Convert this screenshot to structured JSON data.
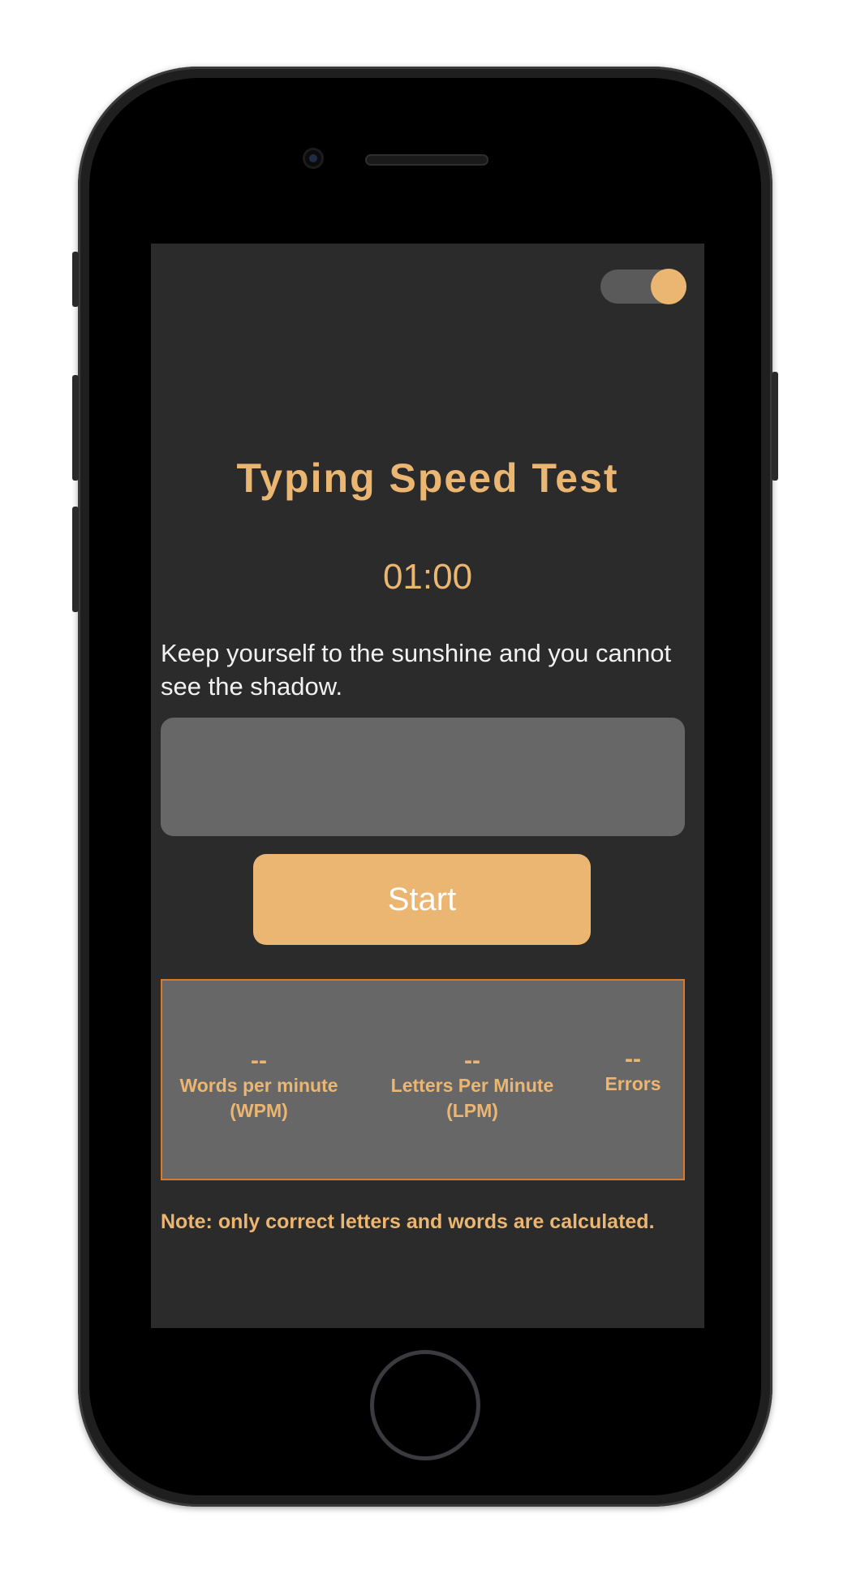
{
  "theme_toggle": {
    "state": "on",
    "accent_color": "#ebb672",
    "track_color": "#5a5a5a"
  },
  "app": {
    "title": "Typing Speed Test",
    "timer": "01:00",
    "prompt_text": "Keep yourself to the sunshine and you cannot see the shadow.",
    "input": {
      "value": "",
      "placeholder": ""
    },
    "start_label": "Start"
  },
  "stats": [
    {
      "value": "--",
      "label": "Words per minute\n(WPM)"
    },
    {
      "value": "--",
      "label": "Letters Per Minute\n(LPM)"
    },
    {
      "value": "--",
      "label": "Errors"
    }
  ],
  "note": "Note: only correct letters and words are calculated.",
  "colors": {
    "background": "#2a2b2a",
    "accent": "#ebb672",
    "panel": "#676767",
    "panel_border": "#d8792c"
  }
}
